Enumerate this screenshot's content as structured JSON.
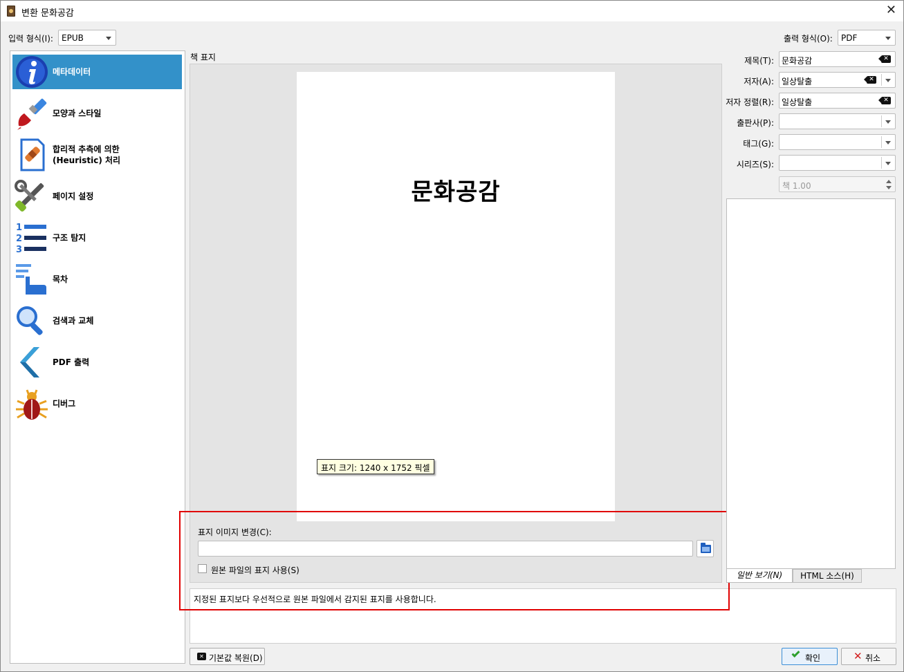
{
  "window": {
    "title": "변환 문화공감"
  },
  "input_format": {
    "label": "입력 형식(I):",
    "value": "EPUB"
  },
  "output_format": {
    "label": "출력 형식(O):",
    "value": "PDF"
  },
  "sidebar": {
    "items": [
      {
        "label": "메타데이터",
        "icon": "info-icon",
        "active": true
      },
      {
        "label": "모양과 스타일",
        "icon": "paintbrush-icon"
      },
      {
        "label": "합리적 추측에 의한",
        "label2": "(Heuristic) 처리",
        "icon": "document-bandage-icon"
      },
      {
        "label": "페이지 설정",
        "icon": "wrench-screwdriver-icon"
      },
      {
        "label": "구조 탐지",
        "icon": "numbered-list-icon"
      },
      {
        "label": "목차",
        "icon": "pointing-hand-icon"
      },
      {
        "label": "검색과 교체",
        "icon": "magnifier-icon"
      },
      {
        "label": "PDF 출력",
        "icon": "chevron-left-icon"
      },
      {
        "label": "디버그",
        "icon": "bug-icon"
      }
    ]
  },
  "cover": {
    "group_label": "책 표지",
    "title_text": "문화공감",
    "tooltip": "표지 크기: 1240 x 1752 픽셀",
    "change_label": "표지 이미지 변경(C):",
    "path_value": "",
    "use_source_label": "원본 파일의 표지 사용(S)",
    "use_source_checked": false,
    "description": "지정된 표지보다 우선적으로 원본 파일에서 감지된 표지를 사용합니다."
  },
  "metadata": {
    "title": {
      "label": "제목(T):",
      "value": "문화공감"
    },
    "author": {
      "label": "저자(A):",
      "value": "일상탈출"
    },
    "author_sort": {
      "label": "저자 정렬(R):",
      "value": "일상탈출"
    },
    "publisher": {
      "label": "출판사(P):",
      "value": ""
    },
    "tags": {
      "label": "태그(G):",
      "value": ""
    },
    "series": {
      "label": "시리즈(S):",
      "value": ""
    },
    "series_index": {
      "value": "책 1.00"
    }
  },
  "comments": {
    "tabs": [
      {
        "label": "일반 보기(N)",
        "active": true
      },
      {
        "label": "HTML 소스(H)",
        "active": false
      }
    ]
  },
  "buttons": {
    "restore": "기본값 복원(D)",
    "ok": "확인",
    "cancel": "취소"
  },
  "colors": {
    "selection": "#3391c9",
    "highlight_box": "#e00000",
    "ok_icon": "#2ea02e",
    "cancel_icon": "#d21e1e"
  }
}
